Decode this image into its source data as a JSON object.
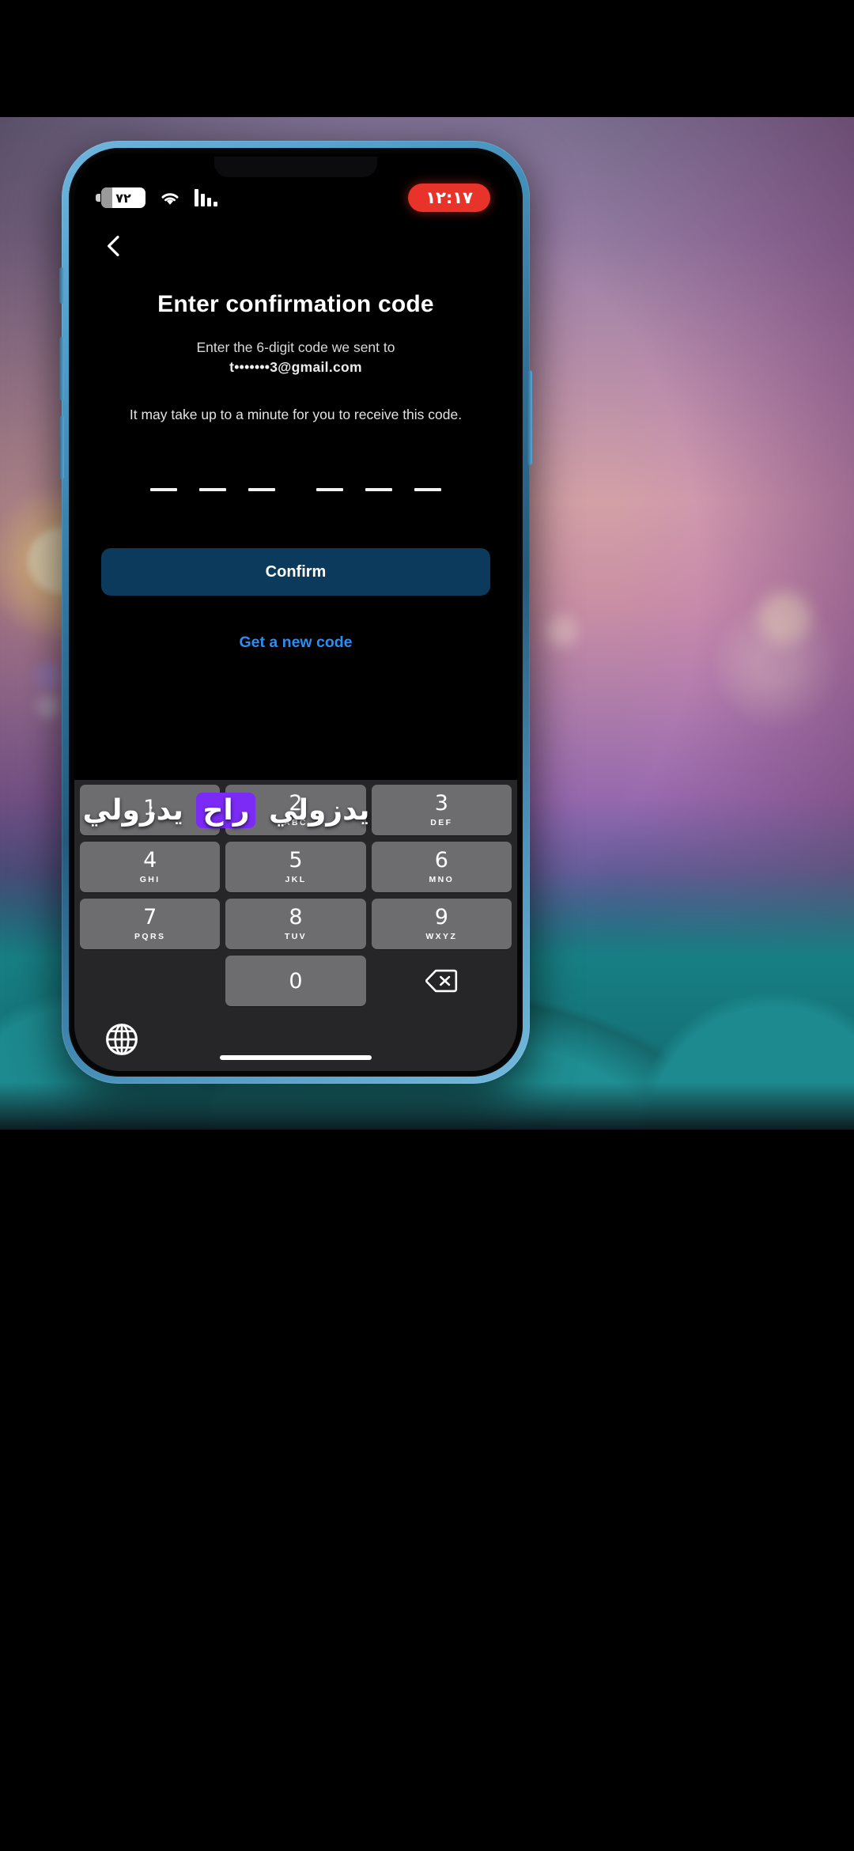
{
  "status_bar": {
    "battery_percent": "٧٢",
    "wifi_icon": "wifi-icon",
    "signal_icon": "cellular-signal-icon",
    "time": "١٢:١٧",
    "time_pill_color": "#e8332a"
  },
  "nav": {
    "back_icon": "back-chevron-icon"
  },
  "screen": {
    "title": "Enter confirmation code",
    "subtitle_line1": "Enter the 6-digit code we sent to",
    "email": "t•••••••3@gmail.com",
    "hint": "It may take up to a minute for you to receive this code.",
    "code_length": 6,
    "code_value": "",
    "confirm_label": "Confirm",
    "confirm_color": "#0c3a5c",
    "new_code_label": "Get a new code",
    "new_code_color": "#2b8ef0"
  },
  "keyboard": {
    "rows": [
      [
        {
          "num": "1",
          "letters": ""
        },
        {
          "num": "2",
          "letters": "ABC"
        },
        {
          "num": "3",
          "letters": "DEF"
        }
      ],
      [
        {
          "num": "4",
          "letters": "GHI"
        },
        {
          "num": "5",
          "letters": "JKL"
        },
        {
          "num": "6",
          "letters": "MNO"
        }
      ],
      [
        {
          "num": "7",
          "letters": "PQRS"
        },
        {
          "num": "8",
          "letters": "TUV"
        },
        {
          "num": "9",
          "letters": "WXYZ"
        }
      ]
    ],
    "zero_key": "0",
    "backspace_icon": "backspace-icon",
    "globe_icon": "globe-language-icon"
  },
  "caption_overlay": {
    "text_before": "يدزولي",
    "highlight_word": "راح",
    "text_after": "يدزولي",
    "highlight_color": "#7b2bf5"
  }
}
